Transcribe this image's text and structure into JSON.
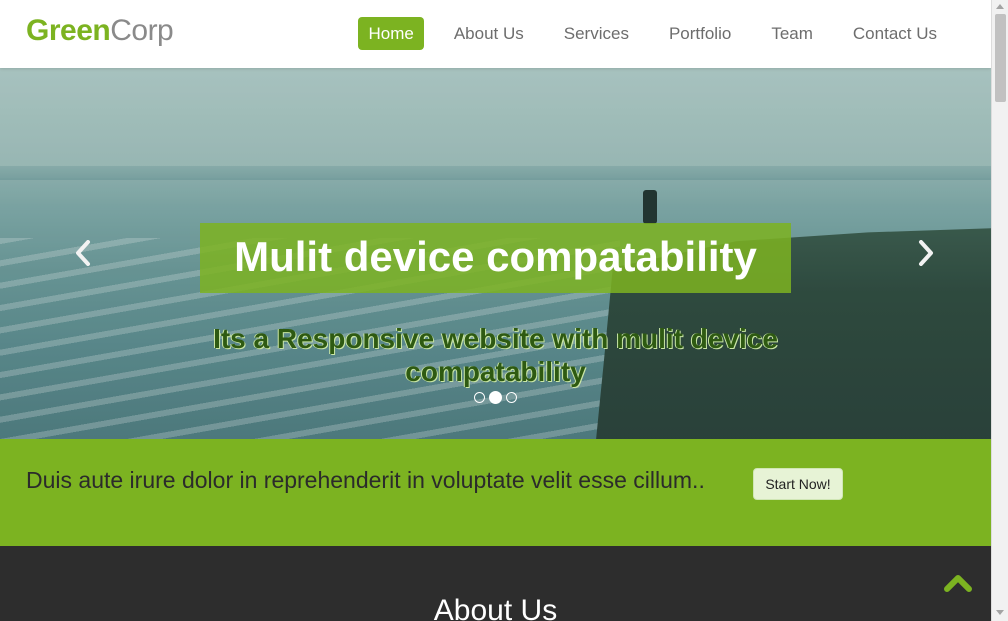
{
  "brand": {
    "part1": "Green",
    "part2": "Corp"
  },
  "nav": {
    "items": [
      {
        "label": "Home",
        "active": true
      },
      {
        "label": "About Us"
      },
      {
        "label": "Services"
      },
      {
        "label": "Portfolio"
      },
      {
        "label": "Team"
      },
      {
        "label": "Contact Us"
      }
    ]
  },
  "hero": {
    "title": "Mulit device compatability",
    "subtitle": "Its a Responsive website with mulit device compatability",
    "prev_icon": "chevron-left-icon",
    "next_icon": "chevron-right-icon",
    "slide_count": 3,
    "active_slide": 2
  },
  "cta": {
    "text": "Duis aute irure dolor in reprehenderit in voluptate velit esse cillum..",
    "button_label": "Start Now!"
  },
  "about": {
    "title": "About Us"
  },
  "colors": {
    "accent": "#7cb321",
    "dark": "#2d2d2d"
  }
}
